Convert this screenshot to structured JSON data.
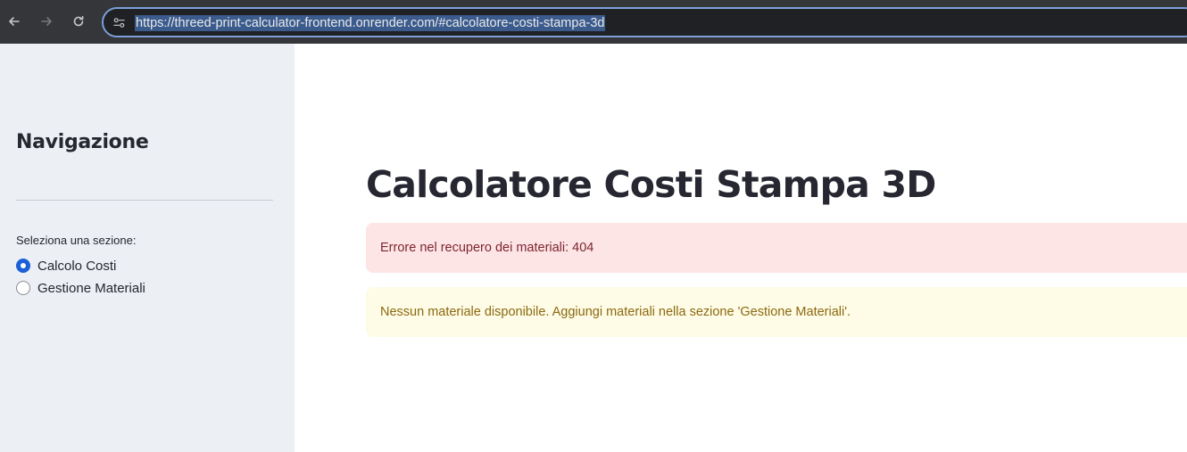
{
  "browser": {
    "url": "https://threed-print-calculator-frontend.onrender.com/#calcolatore-costi-stampa-3d"
  },
  "sidebar": {
    "title": "Navigazione",
    "radio_label": "Seleziona una sezione:",
    "options": [
      {
        "label": "Calcolo Costi",
        "selected": true
      },
      {
        "label": "Gestione Materiali",
        "selected": false
      }
    ]
  },
  "main": {
    "title": "Calcolatore Costi Stampa 3D",
    "error_message": "Errore nel recupero dei materiali: 404",
    "warning_message": "Nessun materiale disponibile. Aggiungi materiali nella sezione 'Gestione Materiali'."
  },
  "colors": {
    "accent": "#1c5fd8",
    "error_bg": "#fde5e6",
    "warning_bg": "#fefbe6",
    "sidebar_bg": "#eceff4"
  }
}
